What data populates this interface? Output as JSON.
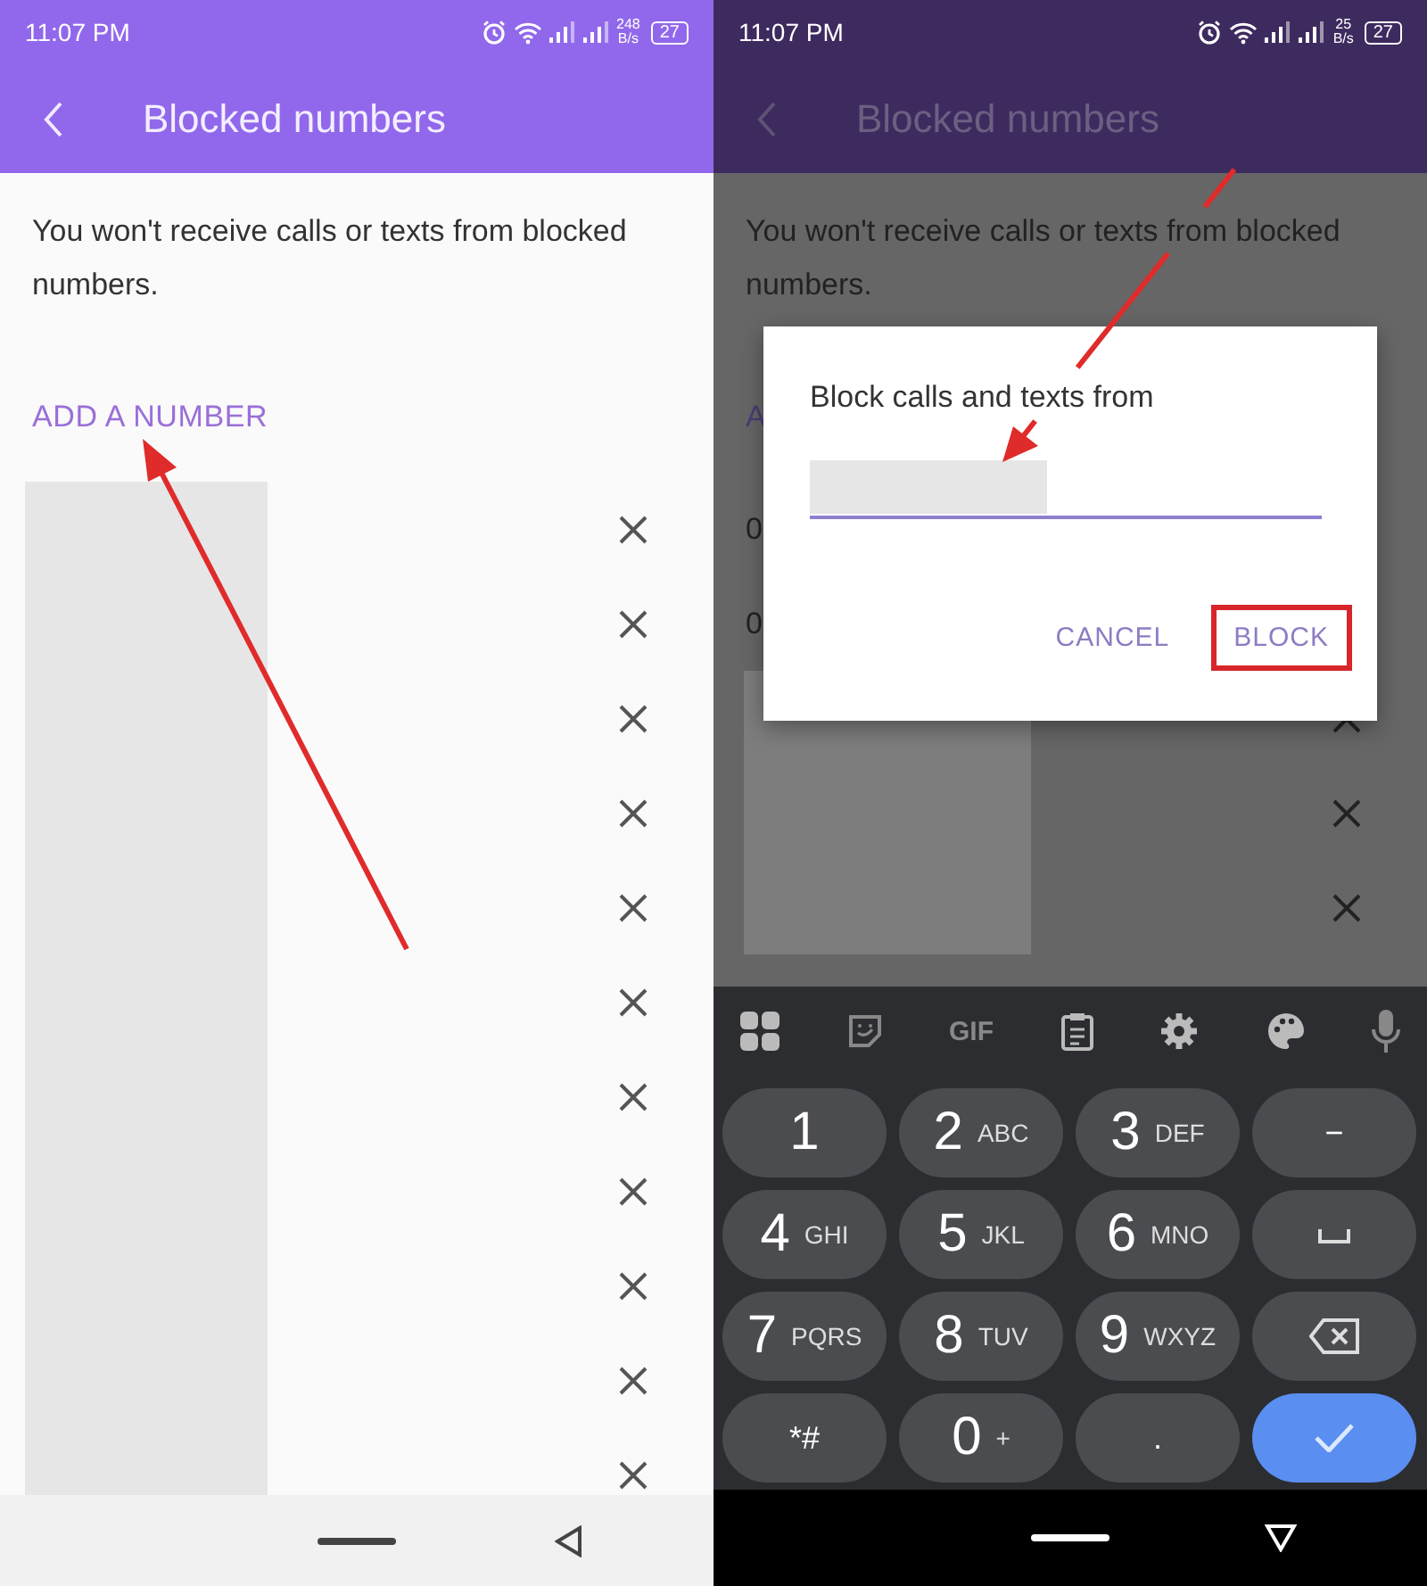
{
  "screens": [
    {
      "dimmed": false,
      "status_bar": {
        "time": "11:07 PM",
        "net_speed": "248",
        "net_unit": "B/s",
        "battery": "27"
      },
      "title": "Blocked numbers",
      "description": "You won't receive calls or texts from blocked numbers.",
      "add_link": "ADD A NUMBER",
      "rows": [
        {
          "kind": "redacted"
        },
        {
          "kind": "redacted"
        },
        {
          "kind": "redacted"
        },
        {
          "kind": "redacted"
        },
        {
          "kind": "redacted"
        },
        {
          "kind": "redacted"
        },
        {
          "kind": "redacted"
        },
        {
          "kind": "redacted"
        },
        {
          "kind": "redacted"
        },
        {
          "kind": "redacted"
        },
        {
          "kind": "redacted"
        }
      ],
      "nav": {
        "kind": "back"
      }
    },
    {
      "dimmed": true,
      "status_bar": {
        "time": "11:07 PM",
        "net_speed": "25",
        "net_unit": "B/s",
        "battery": "27"
      },
      "title": "Blocked numbers",
      "description": "You won't receive calls or texts from blocked numbers.",
      "add_link": "A",
      "rows": [
        {
          "kind": "text",
          "text": "0"
        },
        {
          "kind": "text",
          "text": "0"
        },
        {
          "kind": "redacted"
        },
        {
          "kind": "redacted"
        },
        {
          "kind": "redacted"
        }
      ],
      "dialog": {
        "title": "Block calls and texts from",
        "buttons": [
          {
            "label": "CANCEL",
            "highlighted": false
          },
          {
            "label": "BLOCK",
            "highlighted": true
          }
        ]
      },
      "keyboard": {
        "toolbar": [
          {
            "kind": "grid"
          },
          {
            "kind": "sticker"
          },
          {
            "kind": "text",
            "label": "GIF"
          },
          {
            "kind": "clipboard"
          },
          {
            "kind": "settings"
          },
          {
            "kind": "palette"
          },
          {
            "kind": "mic"
          }
        ],
        "keys": [
          {
            "kind": "digit",
            "digit": "1"
          },
          {
            "kind": "digit",
            "digit": "2",
            "letters": "ABC"
          },
          {
            "kind": "digit",
            "digit": "3",
            "letters": "DEF"
          },
          {
            "kind": "symbol",
            "label": "−"
          },
          {
            "kind": "digit",
            "digit": "4",
            "letters": "GHI"
          },
          {
            "kind": "digit",
            "digit": "5",
            "letters": "JKL"
          },
          {
            "kind": "digit",
            "digit": "6",
            "letters": "MNO"
          },
          {
            "kind": "space"
          },
          {
            "kind": "digit",
            "digit": "7",
            "letters": "PQRS"
          },
          {
            "kind": "digit",
            "digit": "8",
            "letters": "TUV"
          },
          {
            "kind": "digit",
            "digit": "9",
            "letters": "WXYZ"
          },
          {
            "kind": "backspace"
          },
          {
            "kind": "symbol",
            "label": "*#"
          },
          {
            "kind": "digit",
            "digit": "0",
            "letters": "+"
          },
          {
            "kind": "symbol",
            "label": "."
          },
          {
            "kind": "done"
          }
        ]
      },
      "nav": {
        "kind": "down"
      }
    }
  ]
}
